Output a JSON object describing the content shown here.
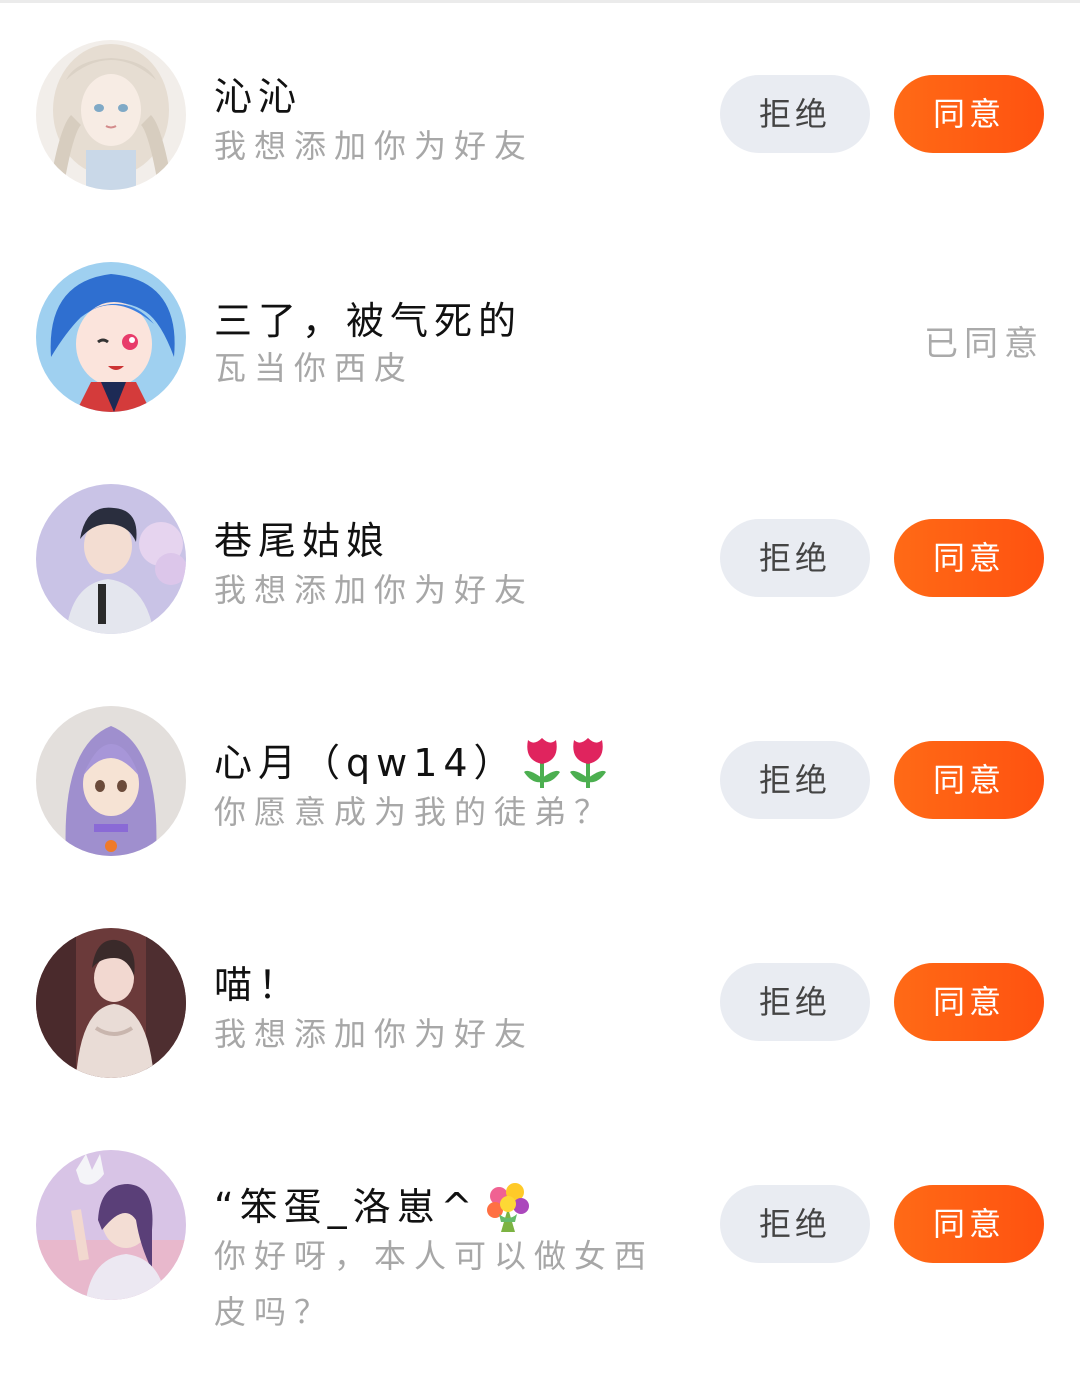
{
  "requests": [
    {
      "name": "沁沁",
      "message": "我想添加你为好友",
      "reject_label": "拒绝",
      "accept_label": "同意",
      "status": null
    },
    {
      "name": "三了，被气死的",
      "message": "瓦当你西皮",
      "reject_label": null,
      "accept_label": null,
      "status": "已同意"
    },
    {
      "name": "巷尾姑娘",
      "message": "我想添加你为好友",
      "reject_label": "拒绝",
      "accept_label": "同意",
      "status": null
    },
    {
      "name": "心月（qw14）",
      "message": "你愿意成为我的徒弟？",
      "reject_label": "拒绝",
      "accept_label": "同意",
      "status": null
    },
    {
      "name": "喵！",
      "message": "我想添加你为好友",
      "reject_label": "拒绝",
      "accept_label": "同意",
      "status": null
    },
    {
      "name": "“笨蛋_洛崽^",
      "message": "你好呀，本人可以做女西皮吗？",
      "reject_label": "拒绝",
      "accept_label": "同意",
      "status": null
    }
  ],
  "colors": {
    "accent": "#ff5a12",
    "reject_bg": "#e9ecf2",
    "muted_text": "#a7a7a7"
  },
  "icons": {
    "tulip": "tulip-emoji",
    "bouquet": "bouquet-emoji"
  }
}
